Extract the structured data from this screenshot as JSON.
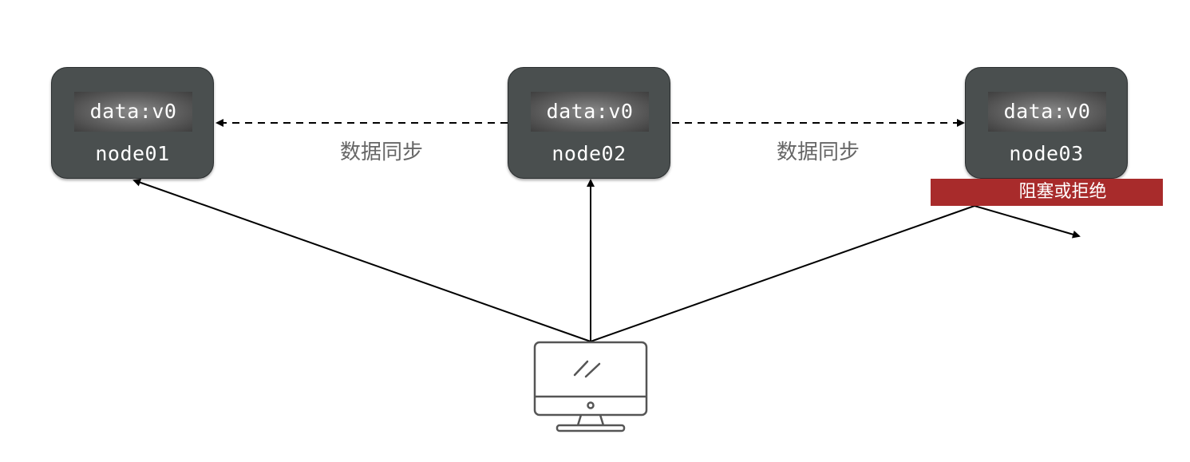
{
  "nodes": [
    {
      "id": "node01",
      "label": "node01",
      "data": "data:v0"
    },
    {
      "id": "node02",
      "label": "node02",
      "data": "data:v0"
    },
    {
      "id": "node03",
      "label": "node03",
      "data": "data:v0"
    }
  ],
  "sync_labels": [
    "数据同步",
    "数据同步"
  ],
  "block_badge": {
    "text": "阻塞或拒绝",
    "color": "#a82b2b"
  },
  "colors": {
    "node_fill": "#4a4f4f",
    "sync_text": "#666666",
    "lines": "#000000"
  },
  "client_icon": "computer-monitor-icon"
}
